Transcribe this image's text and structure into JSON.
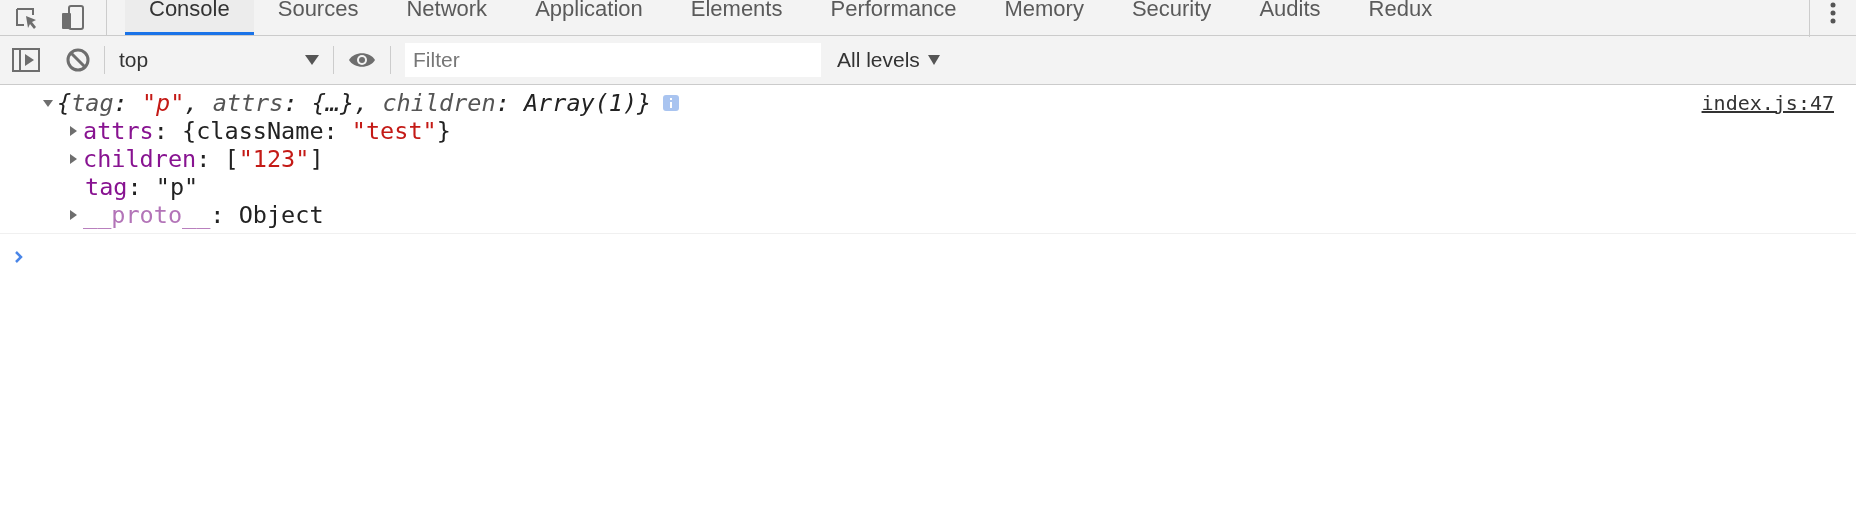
{
  "tabs": [
    {
      "label": "Console",
      "selected": true
    },
    {
      "label": "Sources",
      "selected": false
    },
    {
      "label": "Network",
      "selected": false
    },
    {
      "label": "Application",
      "selected": false
    },
    {
      "label": "Elements",
      "selected": false
    },
    {
      "label": "Performance",
      "selected": false
    },
    {
      "label": "Memory",
      "selected": false
    },
    {
      "label": "Security",
      "selected": false
    },
    {
      "label": "Audits",
      "selected": false
    },
    {
      "label": "Redux",
      "selected": false
    }
  ],
  "toolbar": {
    "context": "top",
    "filter": {
      "placeholder": "Filter"
    },
    "levels": "All levels"
  },
  "log": [
    {
      "expanded": true,
      "source": "index.js:47",
      "summary": [
        {
          "text": "{",
          "kind": "italic"
        },
        {
          "text": "tag",
          "kind": "italic-key"
        },
        {
          "text": ": ",
          "kind": "italic"
        },
        {
          "text": "\"p\"",
          "kind": "italic-string"
        },
        {
          "text": ", ",
          "kind": "italic"
        },
        {
          "text": "attrs",
          "kind": "italic-key"
        },
        {
          "text": ": {…}, ",
          "kind": "italic"
        },
        {
          "text": "children",
          "kind": "italic-key"
        },
        {
          "text": ": Array(1)}",
          "kind": "italic"
        }
      ],
      "properties": [
        {
          "key": "attrs",
          "own": true,
          "kind": "expandable",
          "expanded": false,
          "value": [
            {
              "text": ": ",
              "kind": "plain"
            },
            {
              "text": "{className: ",
              "kind": "plain"
            },
            {
              "text": "\"test\"",
              "kind": "string"
            },
            {
              "text": "}",
              "kind": "plain"
            }
          ]
        },
        {
          "key": "children",
          "own": true,
          "kind": "expandable",
          "expanded": false,
          "value": [
            {
              "text": ": ",
              "kind": "plain"
            },
            {
              "text": "[",
              "kind": "plain"
            },
            {
              "text": "\"123\"",
              "kind": "string"
            },
            {
              "text": "]",
              "kind": "plain"
            }
          ]
        },
        {
          "key": "tag",
          "own": true,
          "kind": "leaf",
          "value": [
            {
              "text": ": ",
              "kind": "plain"
            },
            {
              "text": "\"p\"",
              "kind": "plain"
            }
          ]
        },
        {
          "key": "__proto__",
          "own": false,
          "kind": "expandable",
          "expanded": false,
          "value": [
            {
              "text": ": ",
              "kind": "plain"
            },
            {
              "text": "Object",
              "kind": "plain"
            }
          ]
        }
      ]
    }
  ]
}
